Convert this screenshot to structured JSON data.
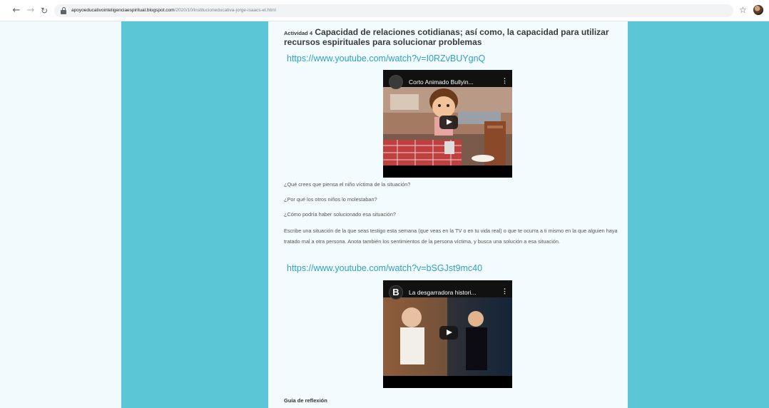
{
  "browser": {
    "back_icon": "arrow-left-icon",
    "forward_icon": "arrow-right-icon",
    "reload_icon": "reload-icon",
    "url_domain": "apoyoeducativointeligenciaespiritual.blogspot.com",
    "url_path": "/2020/10/institucioneducativa-jorge-isaacs-el.html"
  },
  "post": {
    "activity_label": "Actividad 4",
    "heading": "Capacidad de relaciones cotidianas; así como, la capacidad para utilizar recursos espirituales para solucionar problemas",
    "link_1": "https://www.youtube.com/watch?v=I0RZvBUYgnQ",
    "video_1_title": "Corto Animado Bullyin...",
    "questions": [
      "¿Qué crees que piensa el niño víctima de la situación?",
      "¿Por qué los otros niños lo molestaban?",
      "¿Cómo podría haber solucionado esa situación?"
    ],
    "instructions": "Escribe una situación de la que seas testigo esta semana (que veas en la TV o en tu vida real) o que te ocurra a ti mismo en la que alguien haya tratado mal a otra persona. Anota también los sentimientos de la persona víctima, y busca una solución a esa situación.",
    "link_2": "https://www.youtube.com/watch?v=bSGJst9mc40",
    "video_2_channel_letter": "B",
    "video_2_title": "La desgarradora histori...",
    "guia": "Guía de reflexión"
  },
  "colors": {
    "teal": "#5ac6d6",
    "link": "#2fa1c3",
    "page_bg": "#f1fafc"
  }
}
